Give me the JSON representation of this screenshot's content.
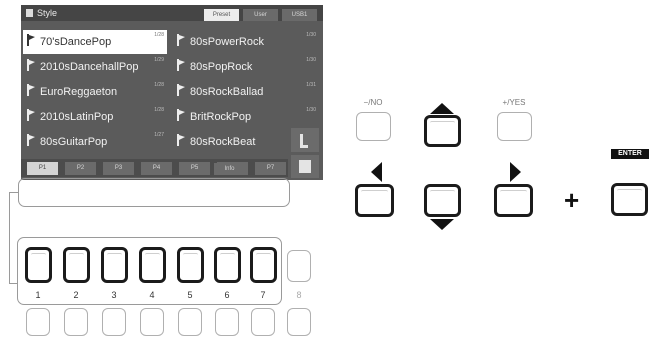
{
  "screen": {
    "title": "Style",
    "tabs": [
      {
        "label": "Preset",
        "active": true
      },
      {
        "label": "User",
        "active": false
      },
      {
        "label": "USB1",
        "active": false
      }
    ],
    "files": [
      {
        "name": "70'sDancePop",
        "num": "1/28",
        "selected": true
      },
      {
        "name": "80sPowerRock",
        "num": "1/30",
        "selected": false
      },
      {
        "name": "2010sDancehallPop",
        "num": "1/29",
        "selected": false
      },
      {
        "name": "80sPopRock",
        "num": "1/30",
        "selected": false
      },
      {
        "name": "EuroReggaeton",
        "num": "1/28",
        "selected": false
      },
      {
        "name": "80sRockBallad",
        "num": "1/31",
        "selected": false
      },
      {
        "name": "2010sLatinPop",
        "num": "1/28",
        "selected": false
      },
      {
        "name": "BritRockPop",
        "num": "1/30",
        "selected": false
      },
      {
        "name": "80sGuitarPop",
        "num": "1/27",
        "selected": false
      },
      {
        "name": "80sRockBeat",
        "num": "1/30",
        "selected": false
      }
    ],
    "pages": [
      "P1",
      "P2",
      "P3",
      "P4",
      "P5",
      "P6",
      "P7"
    ],
    "active_page": "P1",
    "info_label": "Info"
  },
  "panel": {
    "button_numbers": [
      "1",
      "2",
      "3",
      "4",
      "5",
      "6",
      "7",
      "8"
    ]
  },
  "keys": {
    "no_label": "−/NO",
    "yes_label": "+/YES",
    "enter_label": "ENTER",
    "plus_sign": "+"
  }
}
